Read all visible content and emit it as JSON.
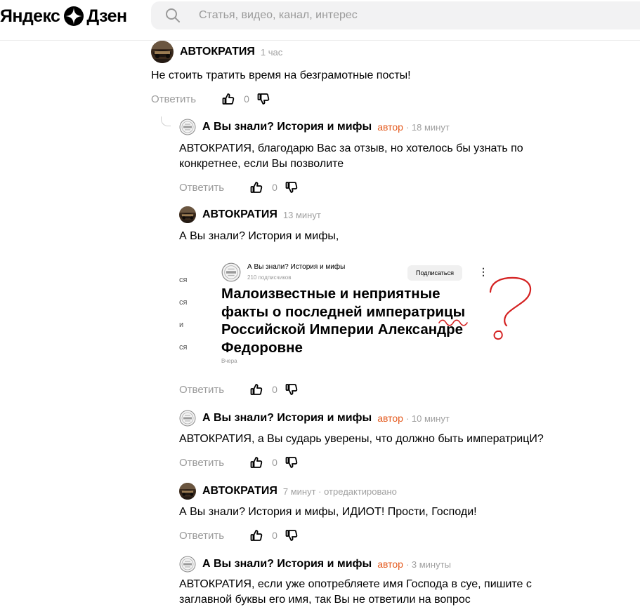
{
  "header": {
    "logo_left": "Яндекс",
    "logo_right": "Дзен",
    "search_placeholder": "Статья, видео, канал, интерес"
  },
  "colors": {
    "author_badge": "#e45a1e",
    "meta_gray": "#a0a0a0",
    "search_bg": "#f2f2f3",
    "ink_red": "#d42020"
  },
  "comments": [
    {
      "name": "АВТОКРАТИЯ",
      "meta": "1 час",
      "text_lines": [
        "Не стоить тратить время на безграмотные посты!"
      ],
      "reply": "Ответить",
      "likes": "0"
    },
    {
      "name": "А Вы знали? История и мифы",
      "badge": "автор",
      "meta": "· 18 минут",
      "text_lines": [
        "АВТОКРАТИЯ, благодарю Вас за отзыв, но хотелось бы узнать по",
        "конкретнее, если Вы позволите"
      ],
      "reply": "Ответить",
      "likes": "0"
    },
    {
      "name": "АВТОКРАТИЯ",
      "meta": "13 минут",
      "text_lines": [
        "А Вы знали? История и мифы,"
      ],
      "reply": "Ответить",
      "likes": "0"
    },
    {
      "name": "А Вы знали? История и мифы",
      "badge": "автор",
      "meta": "· 10 минут",
      "text_lines": [
        "АВТОКРАТИЯ, а Вы сударь уверены, что должно быть императрицИ?"
      ],
      "reply": "Ответить",
      "likes": "0"
    },
    {
      "name": "АВТОКРАТИЯ",
      "meta": "7 минут · отредактировано",
      "text_lines": [
        "А Вы знали? История и мифы, ИДИОТ! Прости, Господи!"
      ],
      "reply": "Ответить",
      "likes": "0"
    },
    {
      "name": "А Вы знали? История и мифы",
      "badge": "автор",
      "meta": "· 3 минуты",
      "text_lines": [
        "АВТОКРАТИЯ, если уже опотребляете имя Господа в суе, пишите с",
        "заглавной буквы его имя, так Вы не ответили на вопрос"
      ]
    }
  ],
  "embed": {
    "side_fragments": [
      "ся",
      "ся",
      "и",
      "ся"
    ],
    "channel": "А Вы знали? История и мифы",
    "subscribers": "210 подписчиков",
    "subscribe_label": "Подписаться",
    "menu_glyph": "⋮",
    "title_lines": [
      "Малоизвестные и неприятные",
      "факты о последней императрицы",
      "Российской Империи Александре",
      "Федоровне"
    ],
    "date": "Вчера"
  },
  "icons": {
    "logo": "zen-star-icon",
    "search": "search-icon",
    "like": "thumbs-up-icon",
    "dislike": "thumbs-down-icon",
    "avatar_channel": "channel-logo-icon",
    "avatar_user": "user-photo-avatar"
  }
}
